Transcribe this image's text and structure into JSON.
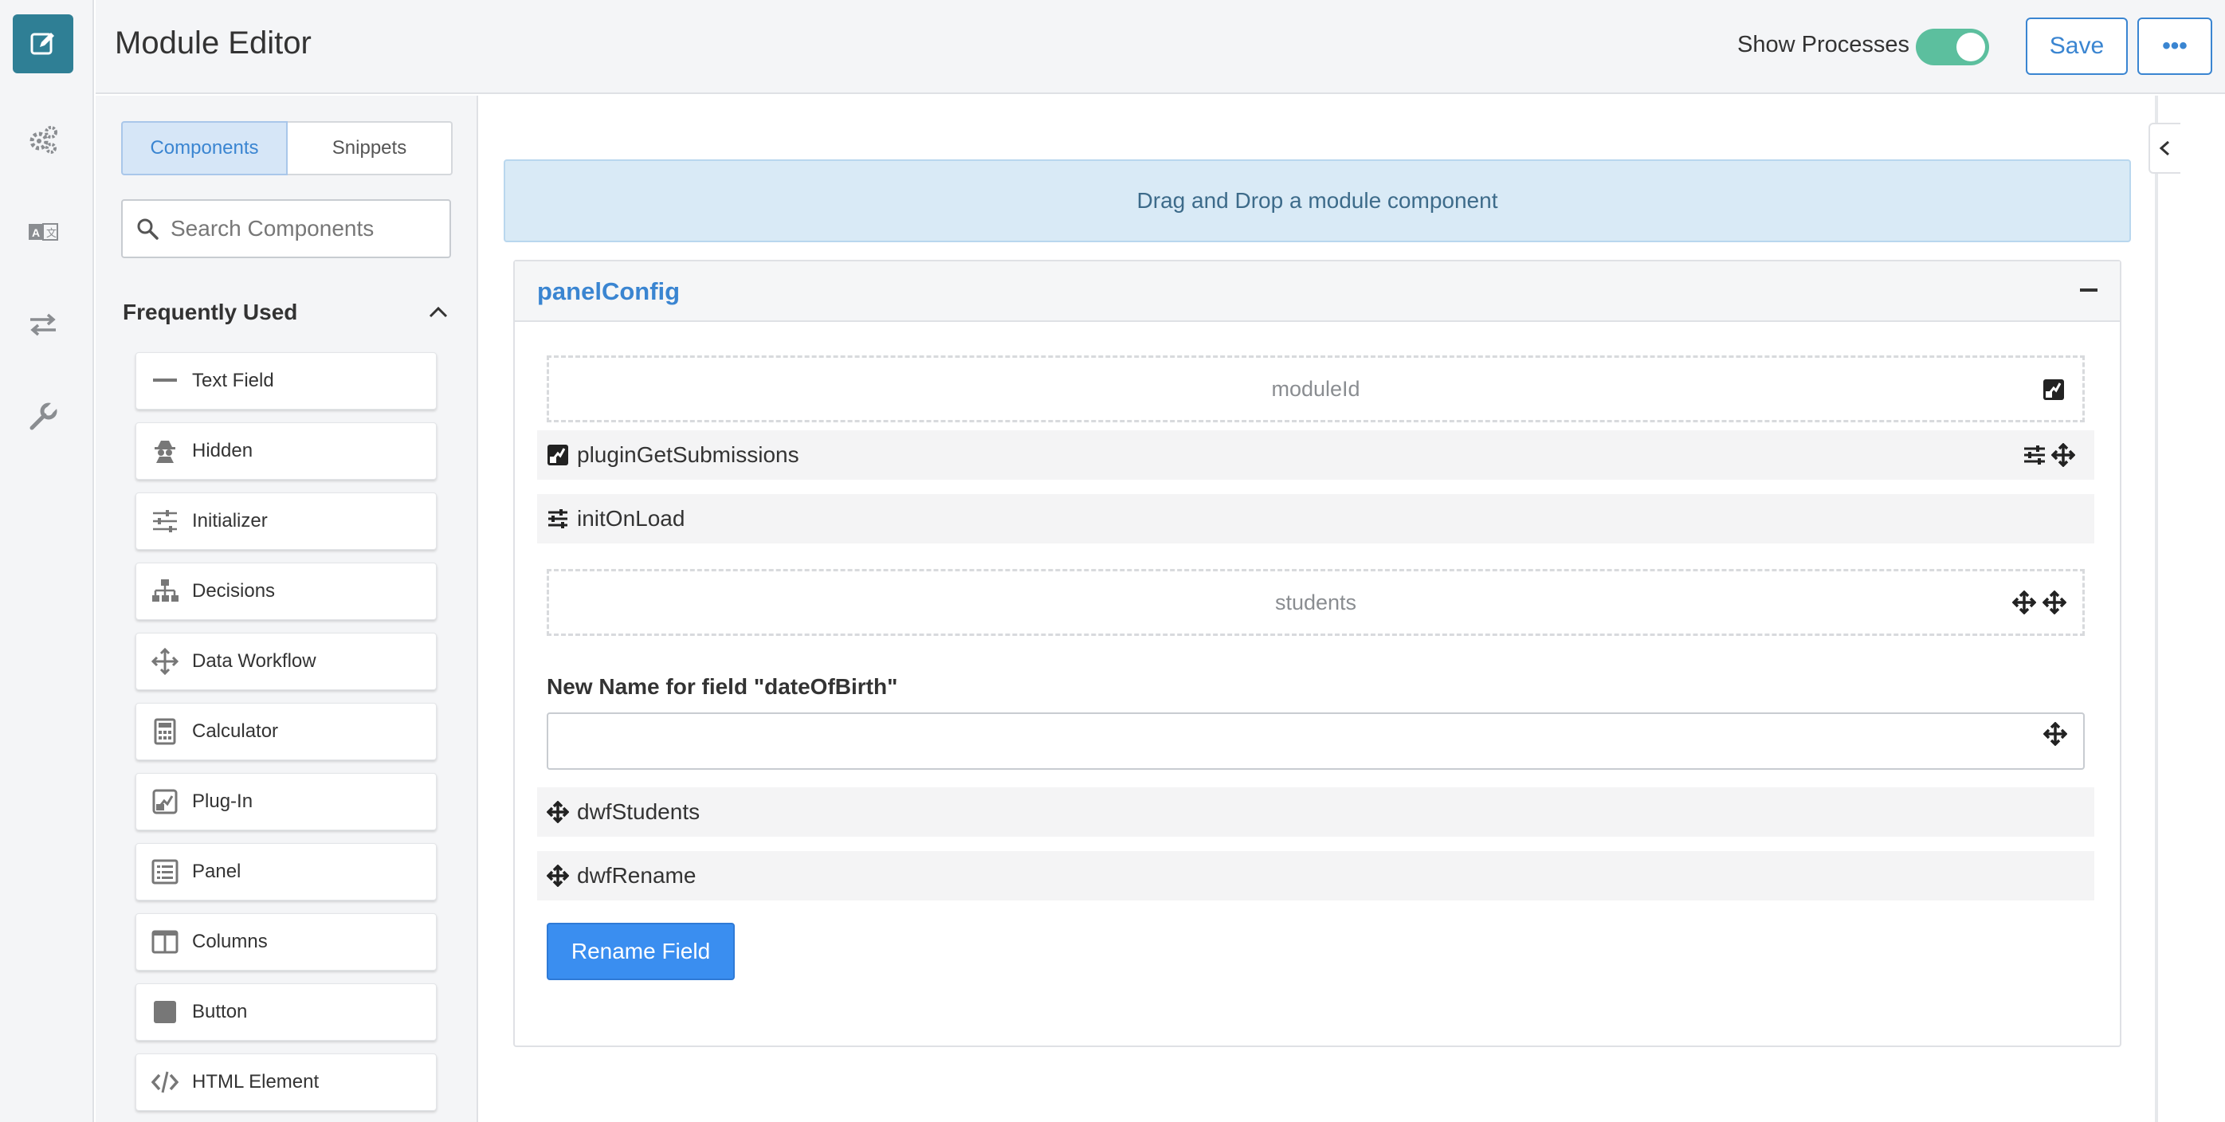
{
  "header": {
    "title": "Module Editor",
    "show_processes_label": "Show Processes",
    "show_processes_on": true,
    "save_label": "Save",
    "more_label": "•••"
  },
  "rail": {
    "items": [
      "edit-icon",
      "gears-icon",
      "translate-icon",
      "swap-arrows-icon",
      "wrench-icon"
    ],
    "active": "edit-icon",
    "accent": "#2f7f95"
  },
  "sidebar": {
    "tabs": [
      {
        "label": "Components",
        "active": true
      },
      {
        "label": "Snippets",
        "active": false
      }
    ],
    "search_placeholder": "Search Components",
    "section_title": "Frequently Used",
    "components": [
      {
        "label": "Text Field",
        "icon": "text-field-icon"
      },
      {
        "label": "Hidden",
        "icon": "hidden-spy-icon"
      },
      {
        "label": "Initializer",
        "icon": "sliders-icon"
      },
      {
        "label": "Decisions",
        "icon": "sitemap-icon"
      },
      {
        "label": "Data Workflow",
        "icon": "arrows-move-icon"
      },
      {
        "label": "Calculator",
        "icon": "calculator-icon"
      },
      {
        "label": "Plug-In",
        "icon": "plugin-icon"
      },
      {
        "label": "Panel",
        "icon": "list-panel-icon"
      },
      {
        "label": "Columns",
        "icon": "columns-icon"
      },
      {
        "label": "Button",
        "icon": "button-square-icon"
      },
      {
        "label": "HTML Element",
        "icon": "code-icon"
      }
    ]
  },
  "canvas": {
    "drop_zone_text": "Drag and Drop a module component",
    "panel": {
      "title": "panelConfig",
      "items": {
        "moduleId": "moduleId",
        "pluginGetSubmissions": "pluginGetSubmissions",
        "initOnLoad": "initOnLoad",
        "students": "students",
        "field_label": "New Name for field \"dateOfBirth\"",
        "field_value": "",
        "dwfStudents": "dwfStudents",
        "dwfRename": "dwfRename",
        "button_label": "Rename Field"
      }
    }
  },
  "colors": {
    "primary": "#3a85d1",
    "toggle_on": "#5cbf9e",
    "drop_zone_bg": "#d9eaf6",
    "button_bg": "#3a8ef0"
  }
}
